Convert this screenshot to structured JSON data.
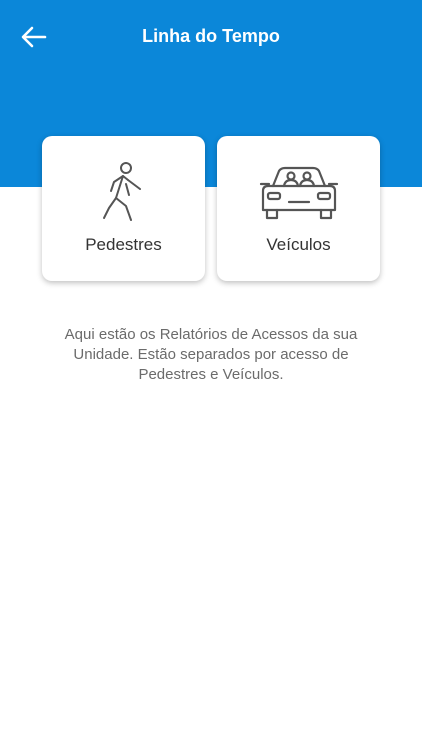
{
  "header": {
    "title": "Linha do Tempo",
    "back_icon": "arrow-left-icon",
    "background_color": "#0b87d9"
  },
  "cards": [
    {
      "label": "Pedestres",
      "icon": "pedestrian-icon"
    },
    {
      "label": "Veículos",
      "icon": "car-icon"
    }
  ],
  "description": "Aqui estão os Relatórios de Acessos da sua Unidade. Estão separados por acesso de Pedestres e Veículos."
}
